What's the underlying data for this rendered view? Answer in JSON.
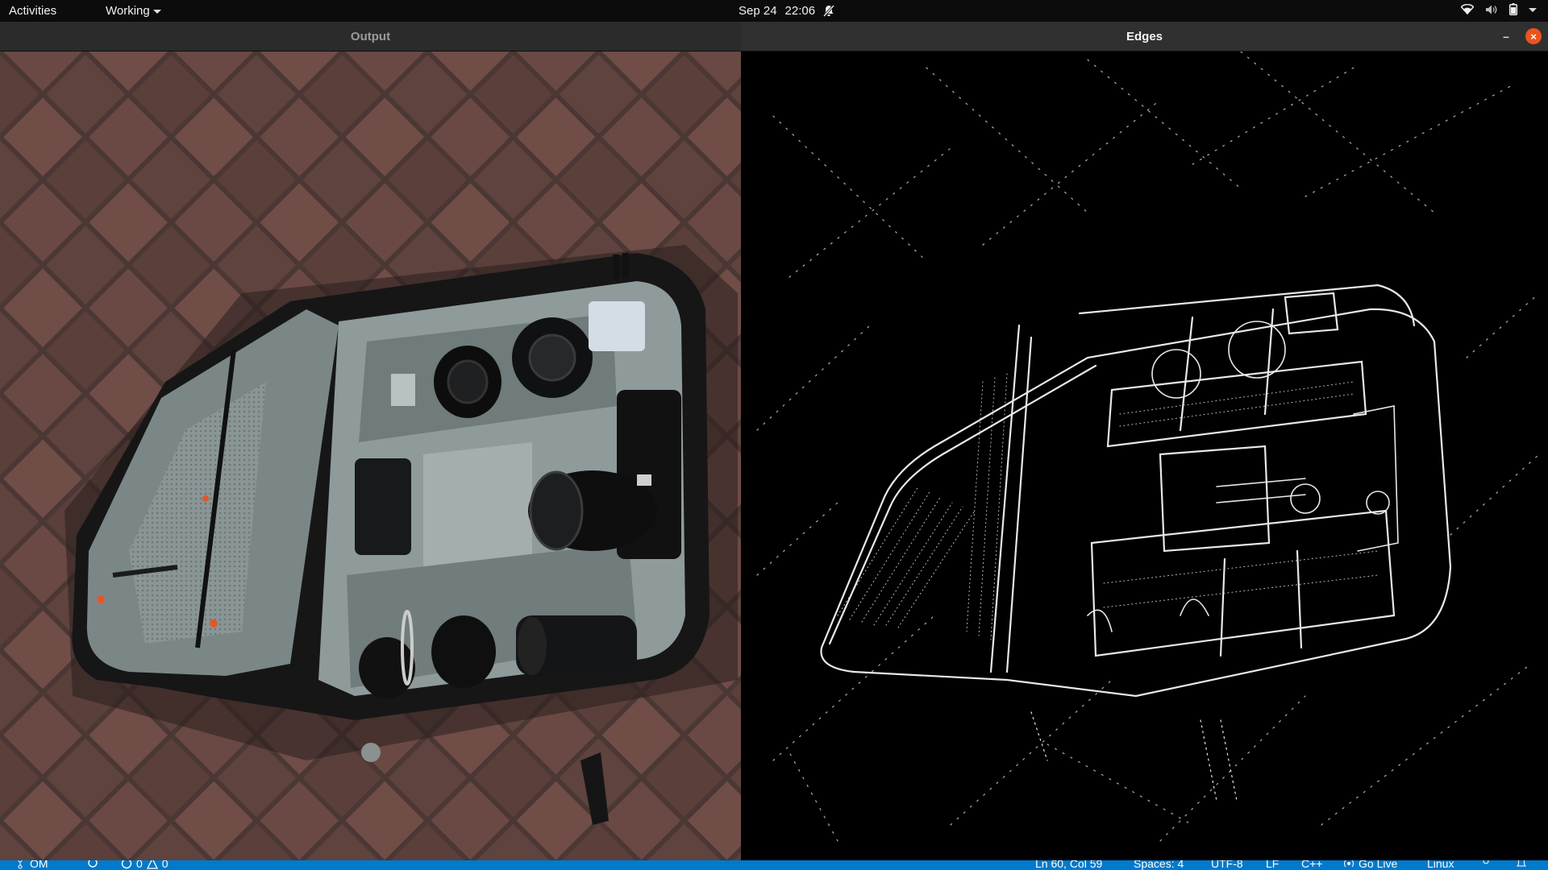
{
  "topbar": {
    "activities": "Activities",
    "app_menu": "Working",
    "date": "Sep 24",
    "time": "22:06"
  },
  "windows": {
    "output": {
      "title": "Output"
    },
    "edges": {
      "title": "Edges",
      "minimize": "–",
      "close": "×"
    }
  },
  "statusbar": {
    "branch": "OM",
    "errors": "0",
    "warnings": "0",
    "position": "Ln 60, Col 59",
    "spaces": "Spaces: 4",
    "encoding": "UTF-8",
    "eol": "LF",
    "language": "C++",
    "go_live": "Go Live",
    "platform": "Linux"
  },
  "colors": {
    "accent": "#e95420",
    "status_bar": "#007acc",
    "brick": "#5d4540"
  }
}
